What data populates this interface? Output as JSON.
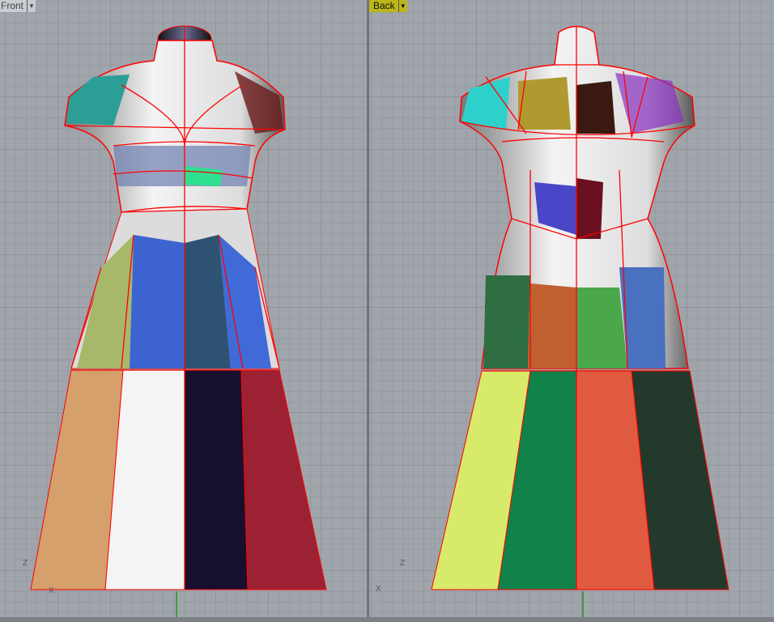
{
  "viewports": [
    {
      "title": "Front",
      "active": false,
      "axis_labels": {
        "vertical": "Z",
        "horizontal": "X"
      }
    },
    {
      "title": "Back",
      "active": true,
      "axis_labels": {
        "vertical": "Z",
        "horizontal": "X"
      }
    }
  ],
  "colors": {
    "active_tab": "#bcb61a",
    "inactive_tab": "#c9ccd2",
    "seam": "#ff0000",
    "background": "#a0a5ab"
  },
  "icons": {
    "dropdown": "caret-down-icon"
  }
}
